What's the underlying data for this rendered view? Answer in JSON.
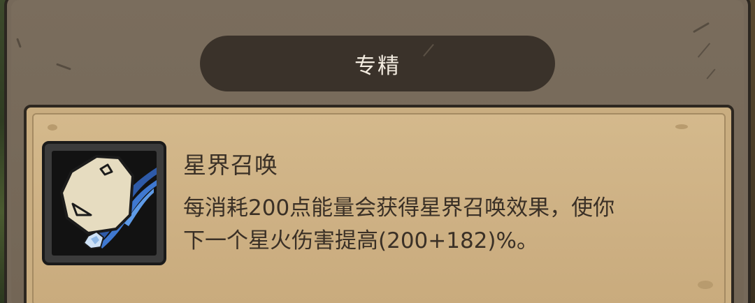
{
  "panel": {
    "title": "专精"
  },
  "skill": {
    "icon": "star-summon-icon",
    "name": "星界召唤",
    "description_lines": [
      "每消耗200点能量会获得星界召唤效果，使你",
      "下一个星火伤害提高(200+182)%。"
    ]
  },
  "colors": {
    "outer_panel": "#76695a",
    "title_banner": "#3a322a",
    "title_text": "#f3ece0",
    "parchment": "#d4b98c",
    "body_text": "#3a3026",
    "icon_blue": "#3a6fc0"
  }
}
